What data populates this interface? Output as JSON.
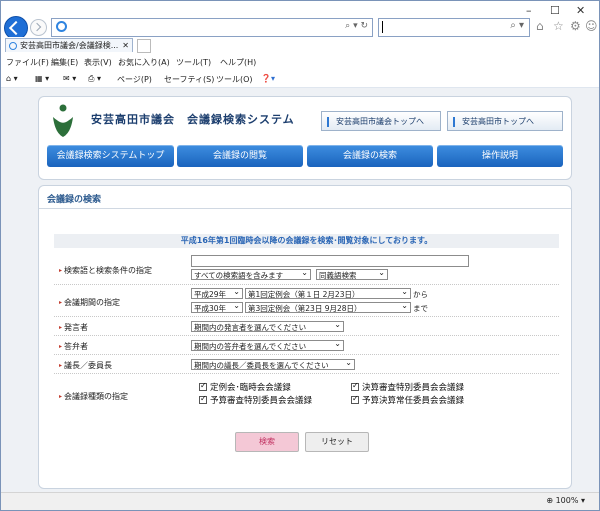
{
  "browser": {
    "address_value": "",
    "search_value": "",
    "tab_title": "安芸高田市議会/会議録検...",
    "menu": [
      "ファイル(F)",
      "編集(E)",
      "表示(V)",
      "お気に入り(A)",
      "ツール(T)",
      "ヘルプ(H)"
    ],
    "commands": {
      "page": "ページ(P)",
      "safety": "セーフティ(S)",
      "tools": "ツール(O)"
    },
    "zoom": "100%"
  },
  "header": {
    "title": "安芸高田市議会　会議録検索システム",
    "link_council": "安芸高田市議会トップへ",
    "link_city": "安芸高田市トップへ"
  },
  "nav": {
    "tabs": [
      "会議録検索システムトップ",
      "会議録の閲覧",
      "会議録の検索",
      "操作説明"
    ]
  },
  "search": {
    "heading": "会議録の検索",
    "notice": "平成16年第1回臨時会以降の会議録を検索･閲覧対象にしております。",
    "keyword": {
      "label": "検索語と検索条件の指定",
      "value": "",
      "condition": "すべての検索語を含みます",
      "mode": "同義語検索"
    },
    "period": {
      "label": "会議期間の指定",
      "from_year": "平成29年",
      "from_session": "第1回定例会（第１日 2月23日）",
      "from_suffix": "から",
      "to_year": "平成30年",
      "to_session": "第3回定例会（第23日 9月28日）",
      "to_suffix": "まで"
    },
    "speaker": {
      "label": "発言者",
      "placeholder": "期間内の発言者を選んでください"
    },
    "respondent": {
      "label": "答弁者",
      "placeholder": "期間内の答弁者を選んでください"
    },
    "chair": {
      "label": "議長／委員長",
      "placeholder": "期間内の議長／委員長を選んでください"
    },
    "types": {
      "label": "会議録種類の指定",
      "options": [
        "定例会･臨時会会議録",
        "決算審査特別委員会会議録",
        "予算審査特別委員会会議録",
        "予算決算常任委員会会議録"
      ]
    },
    "submit_label": "検索",
    "reset_label": "リセット"
  },
  "colors": {
    "nav_blue": "#1a63bd",
    "submit_pink": "#f4c8d6",
    "notice_text": "#2b66b5"
  }
}
